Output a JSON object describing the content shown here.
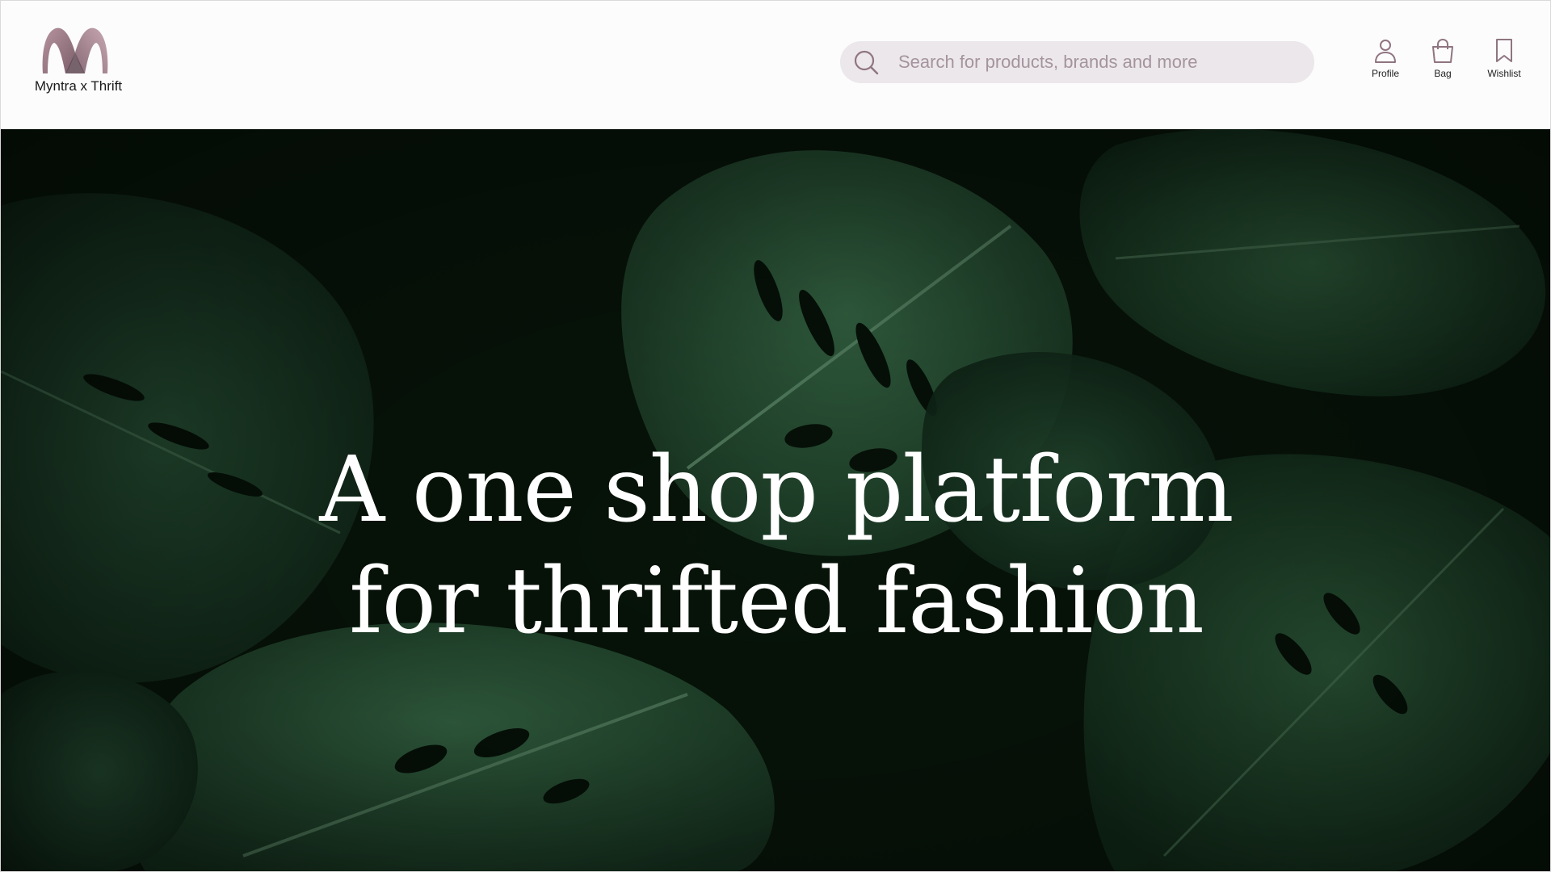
{
  "brand": {
    "name": "Myntra x Thrift",
    "logo_colors": [
      "#8a6a77",
      "#b08f9c",
      "#6d5560"
    ]
  },
  "search": {
    "placeholder": "Search for products, brands and more",
    "icon": "search-icon"
  },
  "nav": [
    {
      "label": "Profile",
      "icon": "person-icon"
    },
    {
      "label": "Bag",
      "icon": "bag-icon"
    },
    {
      "label": "Wishlist",
      "icon": "bookmark-icon"
    }
  ],
  "hero": {
    "line1": "A one shop platform",
    "line2": "for thrifted fashion",
    "background": "monstera-leaves-image"
  },
  "colors": {
    "accent": "#8f7580",
    "search_bg": "#ece7ea",
    "hero_dark": "#061209",
    "leaf_green": "#1f4a2c"
  }
}
